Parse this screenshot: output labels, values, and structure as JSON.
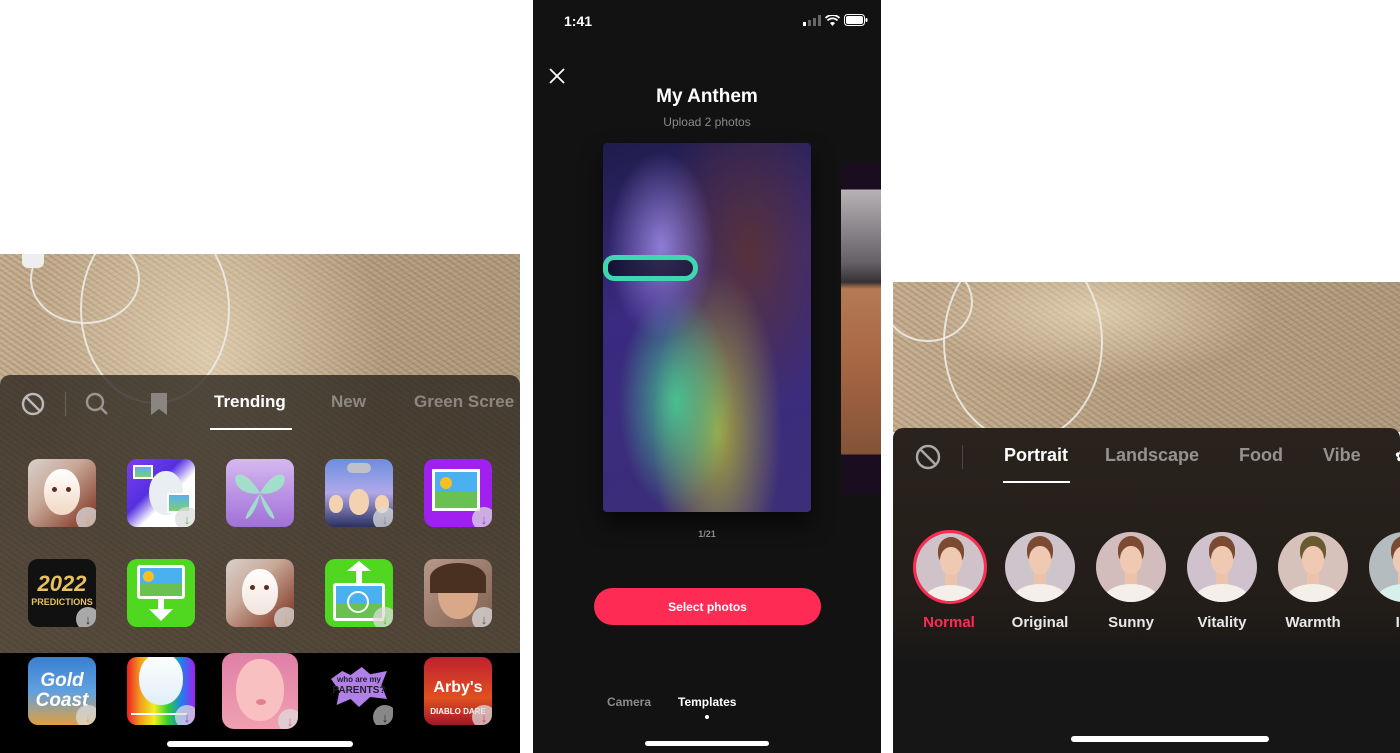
{
  "effects_panel": {
    "tabs": [
      {
        "label": "Trending",
        "active": true
      },
      {
        "label": "New",
        "active": false
      },
      {
        "label": "Green Scree",
        "active": false
      }
    ],
    "icons": [
      "no-effect-icon",
      "search-icon",
      "bookmark-icon"
    ],
    "rows": [
      [
        {
          "name": "mask-face-effect",
          "badge": "↓",
          "badge_color": "#f0a050"
        },
        {
          "name": "photo-swap-effect",
          "badge": "↓",
          "badge_color": "#60c040"
        },
        {
          "name": "butterfly-effect",
          "badge": "",
          "badge_color": ""
        },
        {
          "name": "clone-effect",
          "badge": "↓",
          "badge_color": "#888888"
        },
        {
          "name": "photo-vote-effect",
          "badge": "↓",
          "badge_color": "#9b30e0"
        }
      ],
      [
        {
          "name": "2022-predictions-effect",
          "text": "2022",
          "subtext": "PREDICTIONS",
          "badge": "↓",
          "badge_color": "#333333"
        },
        {
          "name": "green-screen-download-effect",
          "badge": "",
          "badge_color": ""
        },
        {
          "name": "mask-face-effect-2",
          "badge": "↓",
          "badge_color": "#f0a050"
        },
        {
          "name": "green-screen-video-effect",
          "badge": "↓",
          "badge_color": "#60c040"
        },
        {
          "name": "selfie-portrait-effect",
          "badge": "↓",
          "badge_color": "#555555"
        }
      ],
      [
        {
          "name": "gold-coast-effect",
          "text": "Gold",
          "subtext": "Coast",
          "badge": "↓",
          "badge_color": "#f0a050"
        },
        {
          "name": "rainbow-face-effect",
          "badge": "↓",
          "badge_color": "#9b30e0"
        },
        {
          "name": "pink-face-effect",
          "badge": "↓",
          "badge_color": "#e06080"
        },
        {
          "name": "who-are-my-parents-effect",
          "text": "who are my",
          "subtext": "PARENTS?",
          "badge": "↓",
          "badge_color": "#222222"
        },
        {
          "name": "arbys-diablo-dare-effect",
          "text": "Arby's",
          "subtext": "DIABLO DARE",
          "badge": "↓",
          "badge_color": "#e03050"
        }
      ]
    ]
  },
  "templates_panel": {
    "status_time": "1:41",
    "title": "My Anthem",
    "subtitle": "Upload 2 photos",
    "pager": "1/21",
    "select_button": "Select photos",
    "modes": [
      {
        "label": "Camera",
        "active": false
      },
      {
        "label": "Templates",
        "active": true
      }
    ],
    "accent": "#fe2c55"
  },
  "filters_panel": {
    "tabs": [
      {
        "label": "Portrait",
        "active": true
      },
      {
        "label": "Landscape",
        "active": false
      },
      {
        "label": "Food",
        "active": false
      },
      {
        "label": "Vibe",
        "active": false
      }
    ],
    "filters": [
      {
        "label": "Normal",
        "selected": true,
        "tint": "#cfc3c9"
      },
      {
        "label": "Original",
        "selected": false,
        "tint": "#cdc4cc"
      },
      {
        "label": "Sunny",
        "selected": false,
        "tint": "#d3bcbc"
      },
      {
        "label": "Vitality",
        "selected": false,
        "tint": "#cfc2cc"
      },
      {
        "label": "Warmth",
        "selected": false,
        "tint": "#d6c2bb"
      },
      {
        "label": "Isl",
        "selected": false,
        "tint": "#b4bcc0"
      }
    ],
    "accent": "#fe2c55"
  }
}
